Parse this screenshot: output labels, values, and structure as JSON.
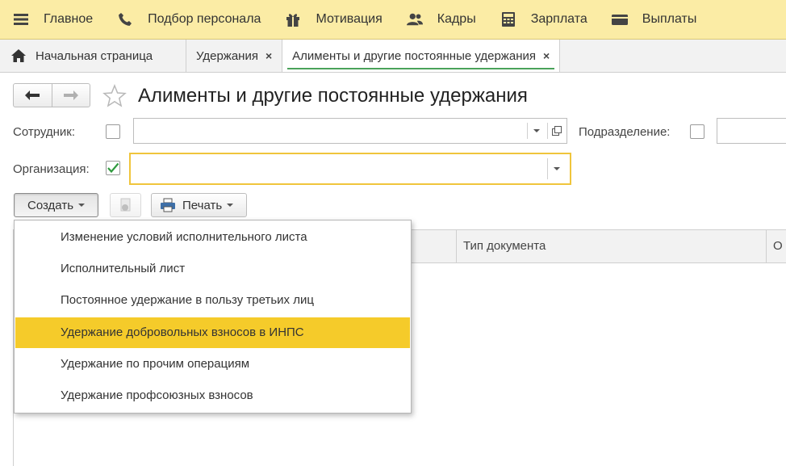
{
  "menubar": {
    "items": [
      {
        "label": "Главное",
        "icon": "hamburger-icon"
      },
      {
        "label": "Подбор персонала",
        "icon": "phone-icon"
      },
      {
        "label": "Мотивация",
        "icon": "gift-icon"
      },
      {
        "label": "Кадры",
        "icon": "people-icon"
      },
      {
        "label": "Зарплата",
        "icon": "calculator-icon"
      },
      {
        "label": "Выплаты",
        "icon": "wallet-icon"
      }
    ],
    "background": "#fbeca5"
  },
  "tabs": [
    {
      "label": "Начальная страница",
      "icon": "home-icon"
    },
    {
      "label": "Удержания",
      "close": "×"
    },
    {
      "label": "Алименты и другие постоянные удержания",
      "close": "×"
    }
  ],
  "page": {
    "title": "Алименты и другие постоянные удержания"
  },
  "filters": {
    "employee_label": "Сотрудник:",
    "employee_value": "",
    "department_label": "Подразделение:",
    "organization_label": "Организация:",
    "organization_value": "",
    "organization_checked": true
  },
  "commands": {
    "create_label": "Создать",
    "print_label": "Печать"
  },
  "table": {
    "columns": [
      "",
      "Тип документа",
      "О"
    ]
  },
  "create_menu": {
    "items": [
      "Изменение условий исполнительного листа",
      "Исполнительный лист",
      "Постоянное удержание в пользу третьих лиц",
      "Удержание добровольных взносов в ИНПС",
      "Удержание по прочим операциям",
      "Удержание профсоюзных взносов"
    ],
    "highlighted_index": 3,
    "highlight_color": "#f5cb2a"
  },
  "colors": {
    "accent_green": "#4aa25a",
    "focus_yellow": "#f0c53c"
  }
}
